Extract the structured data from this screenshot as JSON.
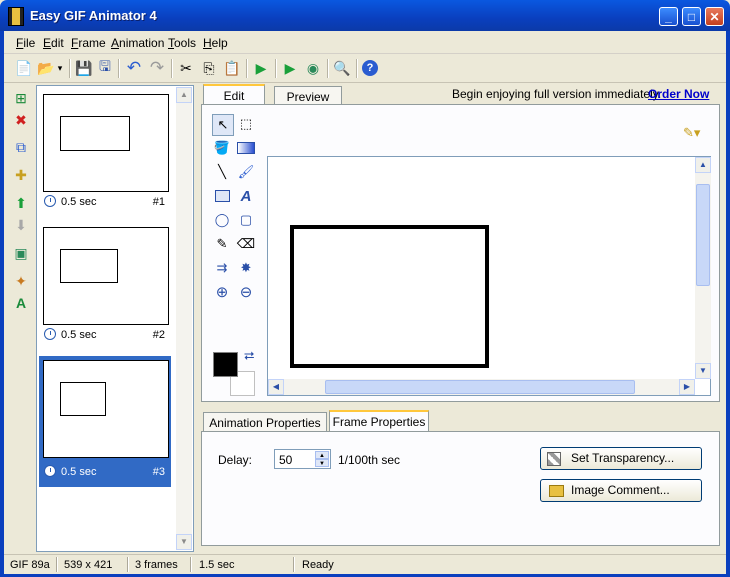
{
  "window": {
    "title": "Easy GIF Animator 4",
    "minimize": "_",
    "maximize": "□",
    "close": "✕"
  },
  "menu": [
    {
      "key": "F",
      "rest": "ile"
    },
    {
      "key": "E",
      "rest": "dit"
    },
    {
      "key": "F",
      "rest": "rame"
    },
    {
      "key": "A",
      "rest": "nimation"
    },
    {
      "key": "T",
      "rest": "ools"
    },
    {
      "key": "H",
      "rest": "elp"
    }
  ],
  "toolbar": {
    "icons": [
      "new-icon",
      "open-icon",
      "dropdown-icon",
      "save-icon",
      "save-all-icon",
      "undo-icon",
      "redo-icon",
      "cut-icon",
      "copy-icon",
      "paste-icon",
      "play-icon",
      "play-from-icon",
      "preview-browser-icon",
      "zoom-preview-icon",
      "help-icon"
    ],
    "glyphs": [
      "📄",
      "📂",
      "▾",
      "💾",
      "🖫",
      "↶",
      "↷",
      "✂",
      "⎘",
      "📋",
      "▶",
      "▶",
      "◉",
      "🔍",
      "?"
    ]
  },
  "left_tools": {
    "icons": [
      "add-frame-icon",
      "delete-frame-icon",
      "duplicate-frame-icon",
      "insert-frame-icon",
      "move-up-icon",
      "move-down-icon",
      "image-effect-icon",
      "wizard-icon",
      "text-banner-icon"
    ],
    "glyphs": [
      "⊞",
      "✖",
      "⧉",
      "✚",
      "⬆",
      "⬇",
      "▣",
      "✦",
      "A"
    ]
  },
  "frames": [
    {
      "time": "0.5 sec",
      "number": "#1"
    },
    {
      "time": "0.5 sec",
      "number": "#2"
    },
    {
      "time": "0.5 sec",
      "number": "#3"
    }
  ],
  "tabs": {
    "edit": "Edit",
    "preview": "Preview"
  },
  "promo": {
    "text": "Begin enjoying full version immediately.",
    "link": "Order Now"
  },
  "tools": {
    "icons": [
      "pointer-icon",
      "select-rect-icon",
      "fill-icon",
      "gradient-icon",
      "line-icon",
      "brush-icon",
      "rectangle-icon",
      "text-icon",
      "ellipse-icon",
      "rounded-rect-icon",
      "eyedropper-icon",
      "eraser-icon",
      "insert-image-icon",
      "spray-icon",
      "zoom-in-icon",
      "zoom-out-icon"
    ],
    "glyphs": [
      "↖",
      "⬚",
      "🪣",
      "▭",
      "╲",
      "🖌",
      "▭",
      "A",
      "◯",
      "▢",
      "✎",
      "⌫",
      "⇉",
      "✸",
      "⊕",
      "⊖"
    ]
  },
  "colors": {
    "foreground": "#000000",
    "background": "#ffffff",
    "selection": "#316ac5"
  },
  "bottom_tabs": {
    "animation": "Animation Properties",
    "frame": "Frame Properties"
  },
  "frame_props": {
    "delay_label": "Delay:",
    "delay_value": "50",
    "delay_unit": "1/100th sec",
    "set_transparency": "Set Transparency...",
    "image_comment": "Image Comment..."
  },
  "status": {
    "format": "GIF 89a",
    "size": "539 x 421",
    "frames": "3 frames",
    "duration": "1.5 sec",
    "state": "Ready"
  }
}
